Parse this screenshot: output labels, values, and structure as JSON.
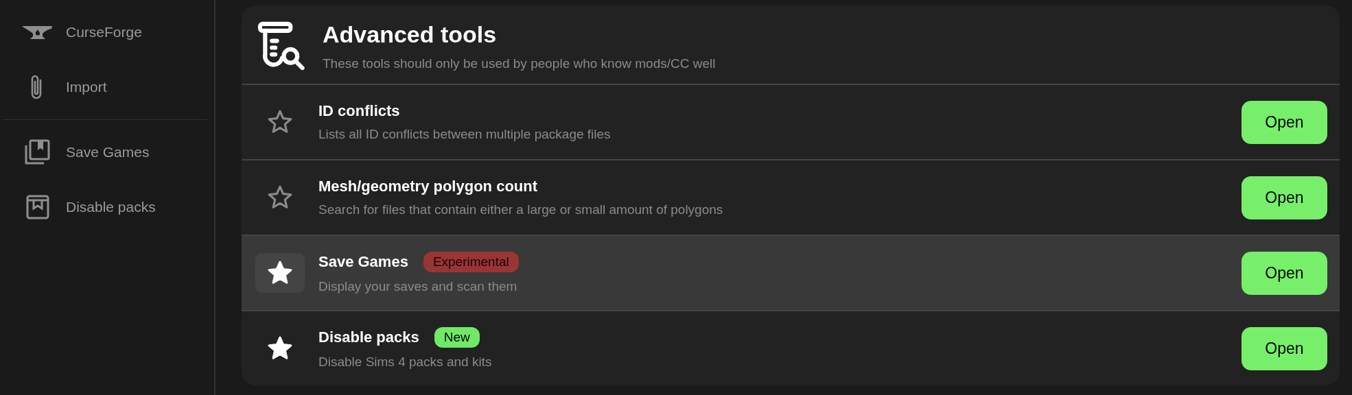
{
  "sidebar": {
    "groups": [
      [
        {
          "label": "CurseForge"
        },
        {
          "label": "Import"
        }
      ],
      [
        {
          "label": "Save Games"
        },
        {
          "label": "Disable packs"
        }
      ]
    ]
  },
  "panel": {
    "title": "Advanced tools",
    "subtitle": "These tools should only be used by people who know mods/CC well",
    "tools": [
      {
        "title": "ID conflicts",
        "description": "Lists all ID conflicts between multiple package files",
        "favorite": false,
        "selected": false,
        "button": "Open"
      },
      {
        "title": "Mesh/geometry polygon count",
        "description": "Search for files that contain either a large or small amount of polygons",
        "favorite": false,
        "selected": false,
        "button": "Open"
      },
      {
        "title": "Save Games",
        "badge": {
          "text": "Experimental",
          "kind": "experimental"
        },
        "description": "Display your saves and scan them",
        "favorite": true,
        "selected": true,
        "button": "Open"
      },
      {
        "title": "Disable packs",
        "badge": {
          "text": "New",
          "kind": "new"
        },
        "description": "Disable Sims 4 packs and kits",
        "favorite": true,
        "selected": false,
        "button": "Open"
      }
    ]
  }
}
